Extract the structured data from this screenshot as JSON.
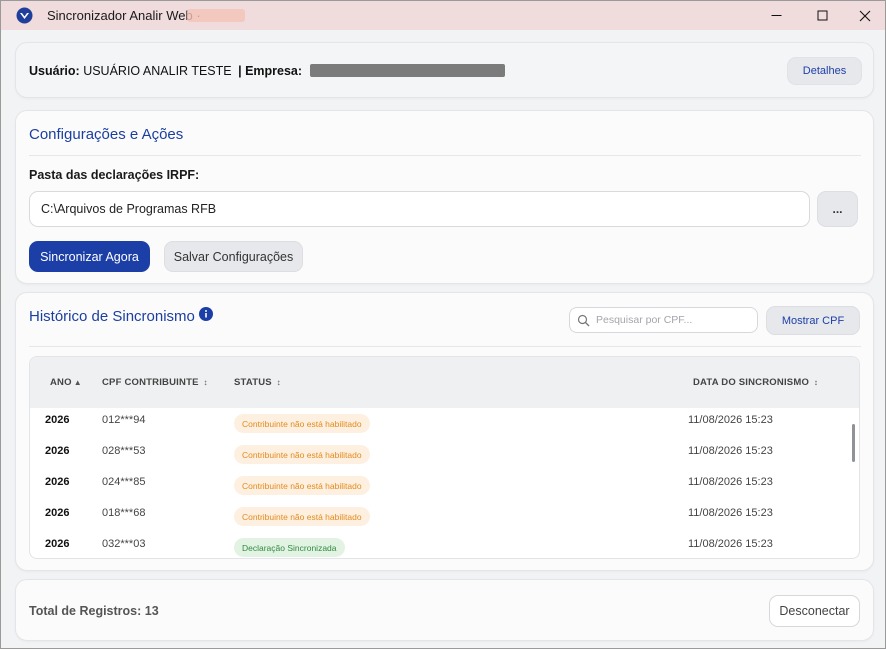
{
  "window": {
    "title": "Sincronizador Analir Web ·",
    "controls": {
      "minimize": "minimize",
      "maximize": "maximize",
      "close": "close"
    }
  },
  "colors": {
    "accent": "#1b3fa6",
    "title_bar": "#f1dcdd",
    "warn_text": "#e48a1c",
    "ok_text": "#2f8a3f"
  },
  "user_bar": {
    "user_label": "Usuário:",
    "user_value": "USUÁRIO ANALIR TESTE",
    "separator": "|",
    "company_label": "Empresa:",
    "details_button": "Detalhes"
  },
  "config": {
    "title": "Configurações e Ações",
    "folder_label": "Pasta das declarações IRPF:",
    "folder_value": "C:\\Arquivos de Programas RFB",
    "browse_button": "...",
    "sync_button": "Sincronizar Agora",
    "save_button": "Salvar Configurações"
  },
  "history": {
    "title": "Histórico de Sincronismo",
    "search_placeholder": "Pesquisar por CPF...",
    "show_cpf_button": "Mostrar CPF",
    "columns": {
      "ano": "ANO",
      "ano_sort": "▲",
      "cpf": "CPF CONTRIBUINTE",
      "cpf_sort": "↕",
      "status": "STATUS",
      "status_sort": "↕",
      "data": "DATA DO SINCRONISMO",
      "data_sort": "↕"
    },
    "rows": [
      {
        "ano": "2026",
        "cpf": "012***94",
        "status": "Contribuinte não está habilitado",
        "status_type": "warn",
        "data": "11/08/2026 15:23"
      },
      {
        "ano": "2026",
        "cpf": "028***53",
        "status": "Contribuinte não está habilitado",
        "status_type": "warn",
        "data": "11/08/2026 15:23"
      },
      {
        "ano": "2026",
        "cpf": "024***85",
        "status": "Contribuinte não está habilitado",
        "status_type": "warn",
        "data": "11/08/2026 15:23"
      },
      {
        "ano": "2026",
        "cpf": "018***68",
        "status": "Contribuinte não está habilitado",
        "status_type": "warn",
        "data": "11/08/2026 15:23"
      },
      {
        "ano": "2026",
        "cpf": "032***03",
        "status": "Declaração Sincronizada",
        "status_type": "ok",
        "data": "11/08/2026 15:23"
      }
    ]
  },
  "footer": {
    "total_text": "Total de Registros: 13",
    "disconnect_button": "Desconectar"
  }
}
